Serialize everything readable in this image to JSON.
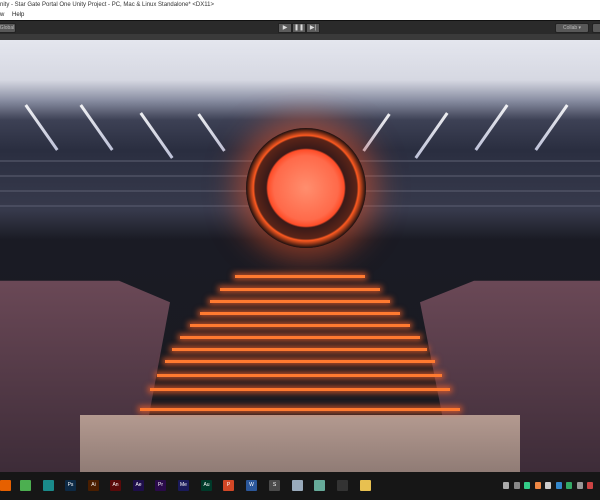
{
  "window": {
    "title": "nity - Star Gate Portal One Unity Project - PC, Mac & Linux Standalone* <DX11>"
  },
  "menu": [
    "w",
    "Help"
  ],
  "toolbar": {
    "global_label": "Global",
    "play_icon": "play-icon",
    "pause_icon": "pause-icon",
    "step_icon": "step-icon",
    "collab_label": "Collab ▾"
  },
  "taskbar": {
    "apps": [
      {
        "name": "firefox",
        "label": "",
        "color": "#e66000"
      },
      {
        "name": "chrome",
        "label": "",
        "color": "#4caf50"
      },
      {
        "name": "app",
        "label": "",
        "color": "#1a8a8a"
      },
      {
        "name": "photoshop",
        "label": "Ps",
        "color": "#0d2a45"
      },
      {
        "name": "illustrator",
        "label": "Ai",
        "color": "#4a1e00"
      },
      {
        "name": "animate",
        "label": "An",
        "color": "#5a0a0a"
      },
      {
        "name": "after-effects",
        "label": "Ae",
        "color": "#1e0e4a"
      },
      {
        "name": "premiere",
        "label": "Pr",
        "color": "#2a0a4a"
      },
      {
        "name": "media-encoder",
        "label": "Me",
        "color": "#1a1a5a"
      },
      {
        "name": "audition",
        "label": "Au",
        "color": "#003a2a"
      },
      {
        "name": "powerpoint",
        "label": "P",
        "color": "#d24726"
      },
      {
        "name": "word",
        "label": "W",
        "color": "#2b579a"
      },
      {
        "name": "sublime",
        "label": "S",
        "color": "#4a4a4a"
      },
      {
        "name": "window-app",
        "label": "",
        "color": "#9ab"
      },
      {
        "name": "tool",
        "label": "",
        "color": "#6a9"
      },
      {
        "name": "unity",
        "label": "",
        "color": "#333"
      },
      {
        "name": "file-explorer",
        "label": "",
        "color": "#e8c050"
      }
    ],
    "tray": [
      "#aaa",
      "#888",
      "#3c8",
      "#e84",
      "#ccc",
      "#38c",
      "#3a6",
      "#999",
      "#c44"
    ]
  }
}
